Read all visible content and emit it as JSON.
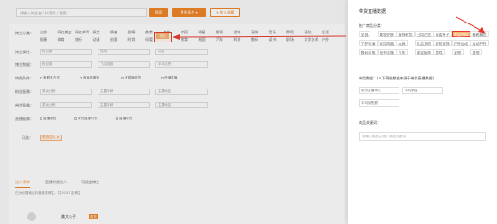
{
  "topbar": {
    "search_placeholder": "请输入博主名 / 抖音号 / 搜索",
    "search_button": "搜索",
    "more_button": "更多条件 ▾",
    "add_button": "+ 加入收藏"
  },
  "filters": {
    "category_label": "博主分类：",
    "categories": [
      "全部",
      "网红美女",
      "网红帅哥",
      "搞笑",
      "情感",
      "剧情",
      "美食",
      "美妆",
      "穿搭",
      "明星",
      "影视",
      "游戏",
      "宠物",
      "音乐",
      "舞蹈",
      "萌娃",
      "生活",
      "健康",
      "体育",
      "旅行",
      "动漫",
      "创意",
      "时尚",
      "母婴",
      "文化",
      "教育",
      "校园",
      "汽车",
      "科技",
      "数码",
      "读书",
      "职场",
      "文学艺术",
      "户外"
    ],
    "highlight_label": "带货",
    "basic_label": "博主属性：",
    "basic_selects": [
      "粉丝数",
      "性别",
      "地区"
    ],
    "data_label": "博主数据：",
    "data_selects": [
      "粉丝数",
      "飞瓜指数",
      "平均点赞"
    ],
    "feature_label": "特色条件：",
    "feature_checks": [
      "有联系方式",
      "有商品橱窗",
      "有直播带货",
      "开通直播"
    ],
    "fans_label": "粉丝画像：",
    "fans_selects": [
      "男女比例",
      "主要年龄",
      "主要地区"
    ],
    "goods_label": "带货画像：",
    "goods_selects": [
      "男女比例",
      "主要年龄",
      "主要地区"
    ],
    "live_label": "直播画像：",
    "live_checks": [
      "直播销售",
      "带货直播时长",
      "直播带货"
    ],
    "applied_label": "已选：",
    "applied_tag": "带货达人 ×"
  },
  "tabs": {
    "items": [
      "达人榜单",
      "直播带货达人",
      "可投放博主"
    ],
    "result_text": "已为你搜索出抖音相关博主，共 5153 名博主",
    "row_name": "美大公子",
    "row_badge": "带货"
  },
  "drawer": {
    "title": "带货直播数据",
    "section1": "推广商品分类：",
    "options": [
      "全部",
      "美妆护肤",
      "服饰鞋包",
      "日用百货",
      "母婴亲子",
      "食品饮料",
      "鞋靴箱包",
      "个护家清",
      "家用电器",
      "玩具",
      "礼品文创",
      "家纺家饰",
      "户外运动",
      "运动户外",
      "数码家电",
      "图书音像",
      "汽车",
      "珠宝配饰",
      "游戏",
      "宠物",
      "其他"
    ],
    "highlight_option": "食品饮料",
    "section2": "带货数据：(以下筛选数据来源于带货直播数据)",
    "selects": [
      "带货直播场次",
      "平均销量",
      "平均销售额"
    ],
    "section3": "商品关键词：",
    "keyword_placeholder": "请输入商品名/推广商品关键词"
  }
}
